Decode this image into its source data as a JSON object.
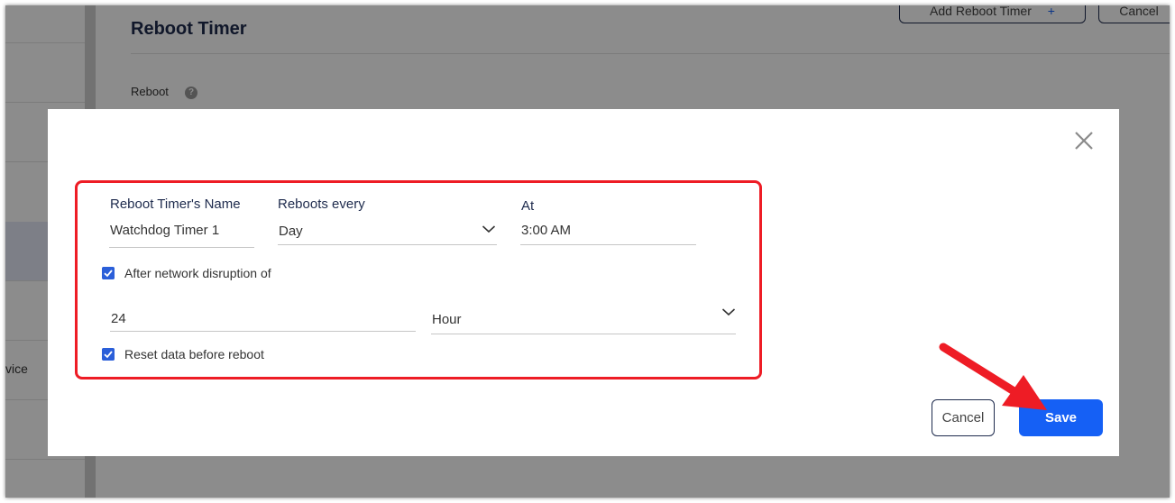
{
  "background": {
    "page_title": "Reboot Timer",
    "reboot_label": "Reboot",
    "help_glyph": "?",
    "add_button": "Add Reboot Timer",
    "add_button_glyph": "+",
    "cancel_button": "Cancel",
    "left_partial_text": "vice"
  },
  "dialog": {
    "close_icon": "close-icon",
    "fields": {
      "name_label": "Reboot Timer's Name",
      "name_value": "Watchdog Timer 1",
      "frequency_label": "Reboots every",
      "frequency_value": "Day",
      "time_label": "At",
      "time_value": "3:00 AM",
      "disruption_checkbox_label": "After network disruption of",
      "disruption_checked": true,
      "disruption_amount": "24",
      "disruption_unit": "Hour",
      "reset_checkbox_label": "Reset data before reboot",
      "reset_checked": true
    },
    "cancel_label": "Cancel",
    "save_label": "Save"
  },
  "colors": {
    "highlight_box": "#ee1c25",
    "arrow": "#ee1c25",
    "primary_button": "#1560f5",
    "checkbox": "#2b5fd9",
    "label_text": "#1e2b4d"
  }
}
